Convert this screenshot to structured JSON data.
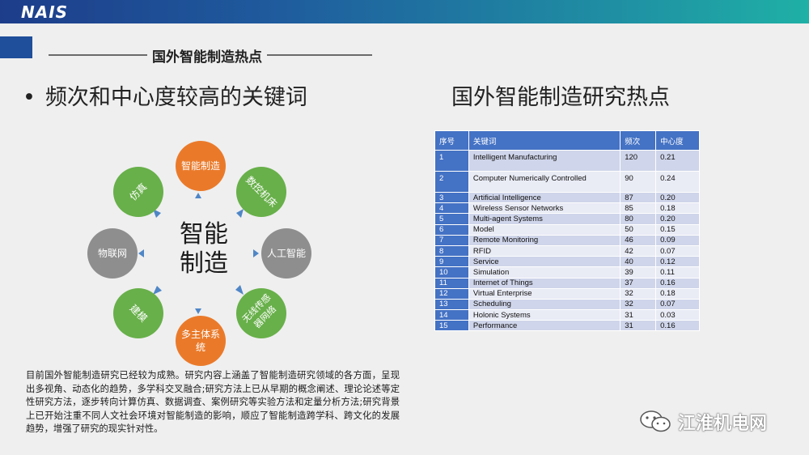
{
  "header": {
    "logo": "NAIS"
  },
  "section_title": "国外智能制造热点",
  "bullet": {
    "dot": "•",
    "text": "频次和中心度较高的关键词"
  },
  "table_title": "国外智能制造研究热点",
  "diagram": {
    "center_line1": "智能",
    "center_line2": "制造",
    "nodes": {
      "top": "智能制造",
      "top_right": "数控机床",
      "right": "人工智能",
      "bottom_right": "无线传感器网络",
      "bottom": "多主体系统",
      "bottom_left": "建模",
      "left": "物联网",
      "top_left": "仿真"
    },
    "colors": {
      "orange": "#ea7a2a",
      "green": "#68b04a",
      "gray": "#8e8e8e",
      "arrow": "#4f86c6"
    }
  },
  "table": {
    "headers": [
      "序号",
      "关键词",
      "频次",
      "中心度"
    ],
    "rows": [
      [
        "1",
        "Intelligent Manufacturing",
        "120",
        "0.21"
      ],
      [
        "2",
        "Computer Numerically Controlled",
        "90",
        "0.24"
      ],
      [
        "3",
        "Artificial Intelligence",
        "87",
        "0.20"
      ],
      [
        "4",
        "Wireless Sensor Networks",
        "85",
        "0.18"
      ],
      [
        "5",
        "Multi-agent Systems",
        "80",
        "0.20"
      ],
      [
        "6",
        "Model",
        "50",
        "0.15"
      ],
      [
        "7",
        "Remote Monitoring",
        "46",
        "0.09"
      ],
      [
        "8",
        "RFID",
        "42",
        "0.07"
      ],
      [
        "9",
        "Service",
        "40",
        "0.12"
      ],
      [
        "10",
        "Simulation",
        "39",
        "0.11"
      ],
      [
        "11",
        "Internet of Things",
        "37",
        "0.16"
      ],
      [
        "12",
        "Virtual Enterprise",
        "32",
        "0.18"
      ],
      [
        "13",
        "Scheduling",
        "32",
        "0.07"
      ],
      [
        "14",
        "Holonic Systems",
        "31",
        "0.03"
      ],
      [
        "15",
        "Performance",
        "31",
        "0.16"
      ]
    ]
  },
  "paragraph": "目前国外智能制造研究已经较为成熟。研究内容上涵盖了智能制造研究领域的各方面，呈现出多视角、动态化的趋势，多学科交叉融合;研究方法上已从早期的概念阐述、理论论述等定性研究方法，逐步转向计算仿真、数据调查、案例研究等实验方法和定量分析方法;研究背景上已开始注重不同人文社会环境对智能制造的影响，顺应了智能制造跨学科、跨文化的发展趋势，增强了研究的现实针对性。",
  "watermark": {
    "text": "江淮机电网",
    "icon": "wechat-icon"
  }
}
